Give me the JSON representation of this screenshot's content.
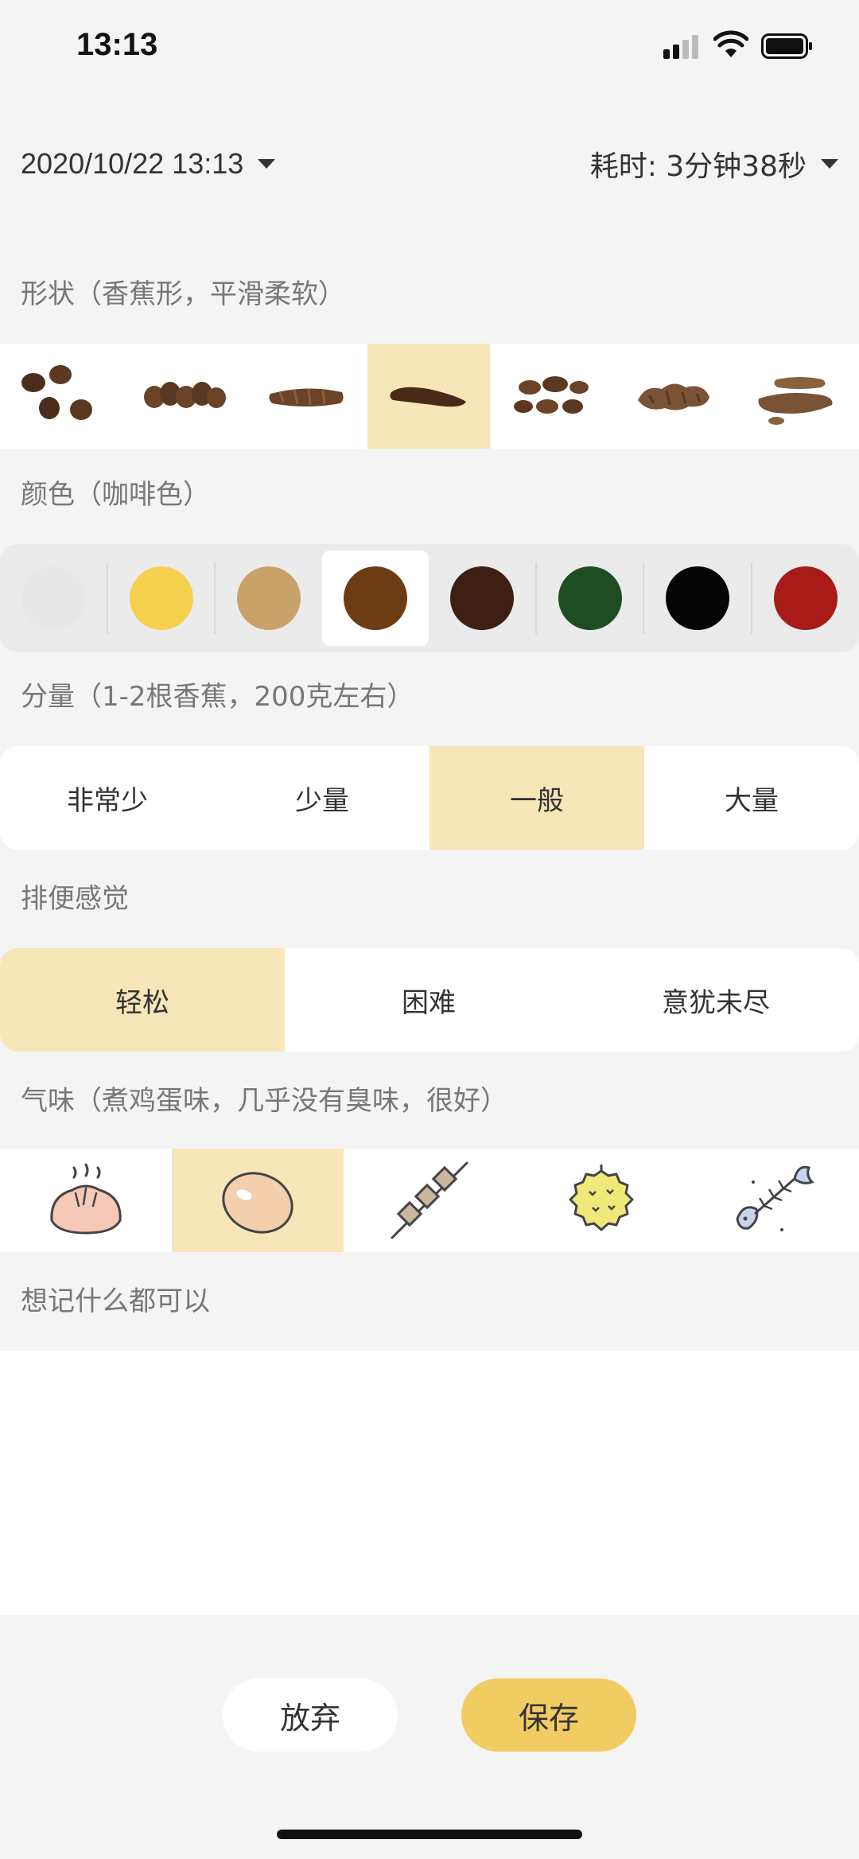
{
  "status_bar": {
    "time": "13:13"
  },
  "header": {
    "datetime": "2020/10/22 13:13",
    "duration": "耗时: 3分钟38秒"
  },
  "shape": {
    "label": "形状（香蕉形，平滑柔软）",
    "options": [
      "shape-1",
      "shape-2",
      "shape-3",
      "shape-4",
      "shape-5",
      "shape-6",
      "shape-7"
    ],
    "selected_index": 3
  },
  "color": {
    "label": "颜色（咖啡色）",
    "swatches": [
      "#e8e8e8",
      "#f5cf4e",
      "#c9a26a",
      "#6e3c13",
      "#3f1f12",
      "#1e4d22",
      "#050505",
      "#a81b18"
    ],
    "selected_index": 3
  },
  "amount": {
    "label": "分量（1-2根香蕉，200克左右）",
    "options": [
      "非常少",
      "少量",
      "一般",
      "大量"
    ],
    "selected_index": 2
  },
  "feeling": {
    "label": "排便感觉",
    "options": [
      "轻松",
      "困难",
      "意犹未尽"
    ],
    "selected_index": 0
  },
  "smell": {
    "label": "气味（煮鸡蛋味，几乎没有臭味，很好）",
    "options": [
      "steamed-bun-icon",
      "egg-icon",
      "skewer-icon",
      "durian-icon",
      "fishbone-icon"
    ],
    "selected_index": 1
  },
  "notes": {
    "placeholder": "想记什么都可以"
  },
  "actions": {
    "discard": "放弃",
    "save": "保存"
  }
}
